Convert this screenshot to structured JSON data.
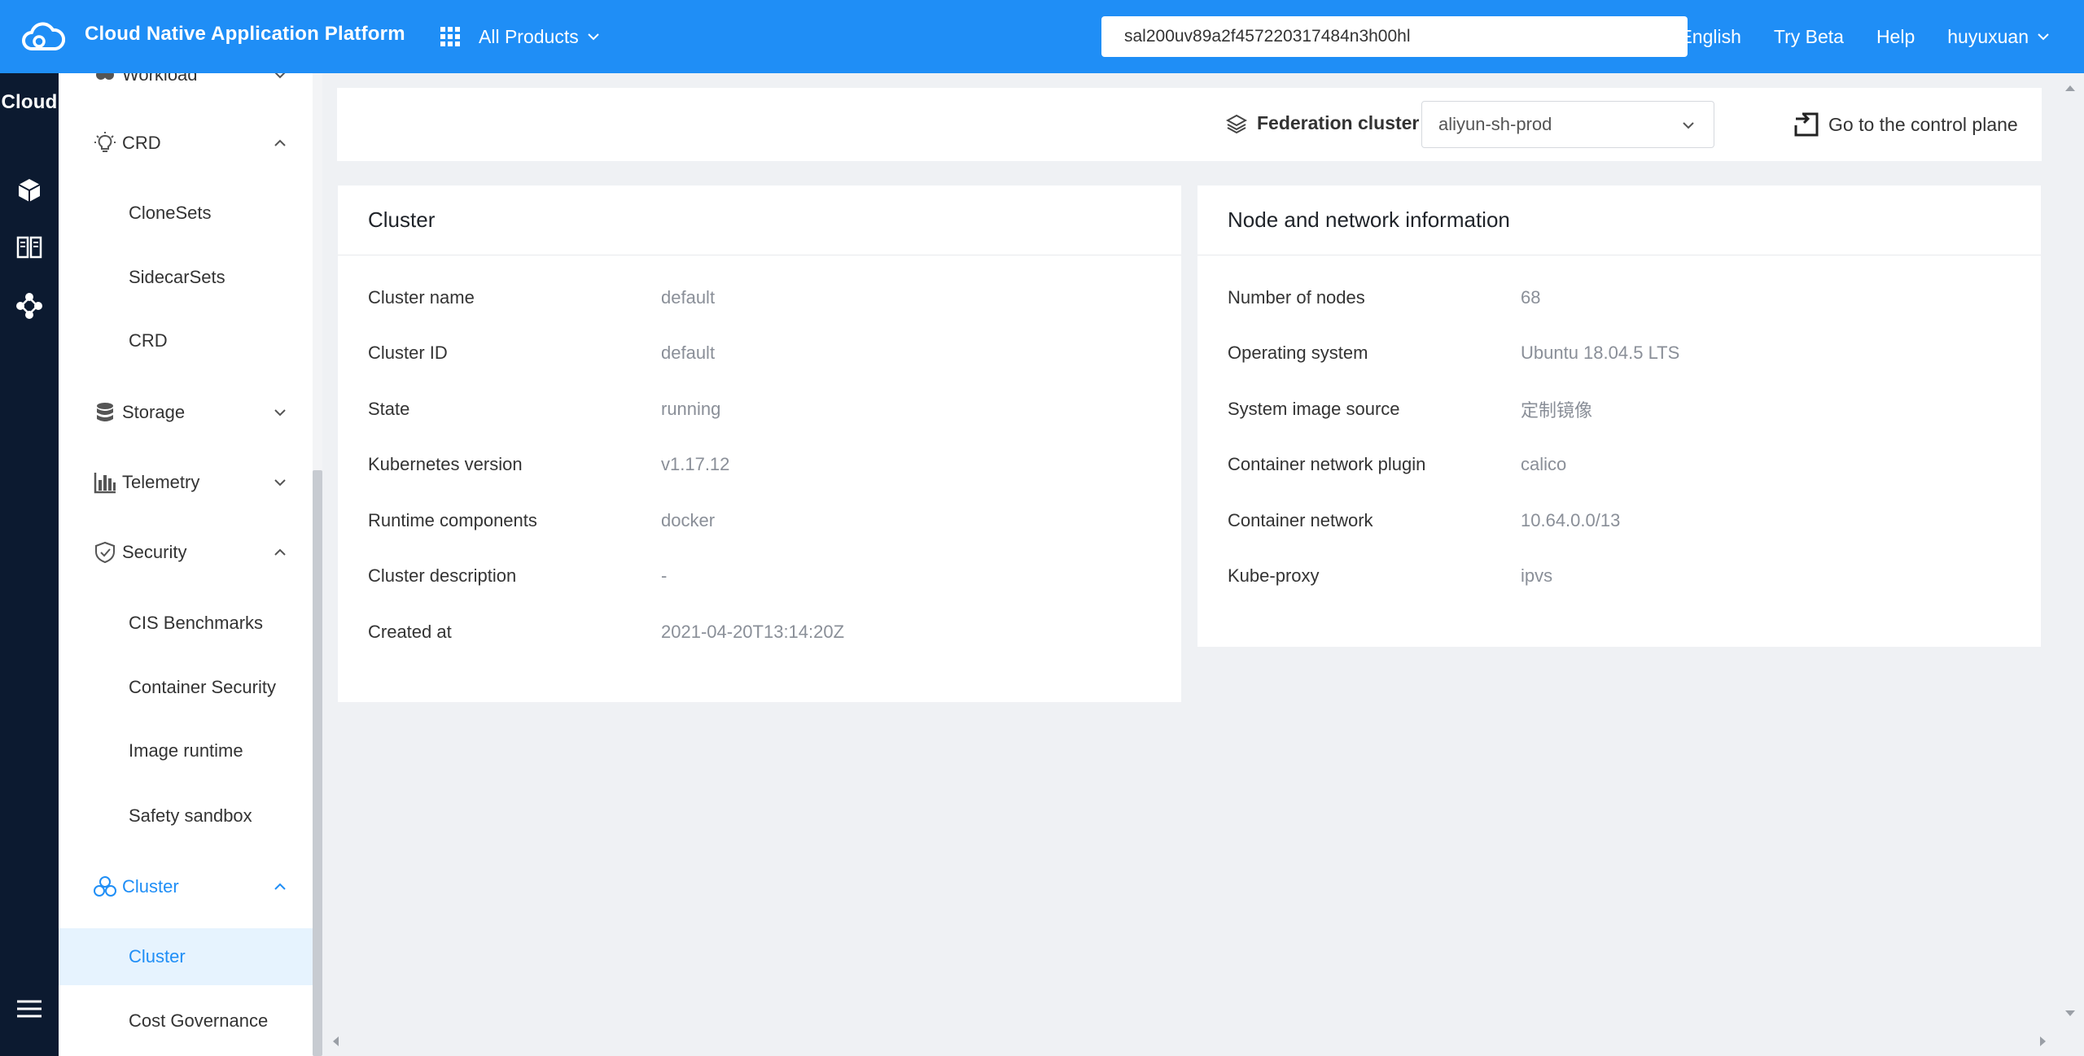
{
  "header": {
    "app_title": "Cloud Native Application Platform",
    "products_label": "All Products",
    "search_value": "sal200uv89a2f457220317484n3h00hl",
    "links": [
      "English",
      "Try Beta",
      "Help"
    ],
    "user": "huyuxuan"
  },
  "rail": {
    "title": "Cloud",
    "icons": [
      "cube-icon",
      "book-icon",
      "network-icon"
    ],
    "menu_icon": "hamburger-icon"
  },
  "sidebar": {
    "workload": "Workload",
    "crd": {
      "label": "CRD",
      "items": [
        "CloneSets",
        "SidecarSets",
        "CRD"
      ]
    },
    "storage": "Storage",
    "telemetry": "Telemetry",
    "security": {
      "label": "Security",
      "items": [
        "CIS Benchmarks",
        "Container Security",
        "Image runtime",
        "Safety sandbox"
      ]
    },
    "cluster": {
      "label": "Cluster",
      "items": [
        "Cluster",
        "Cost Governance"
      ]
    }
  },
  "federation": {
    "label": "Federation cluster",
    "selected": "aliyun-sh-prod",
    "control_plane": "Go to the control plane"
  },
  "cluster_card": {
    "title": "Cluster",
    "rows": [
      {
        "key": "Cluster name",
        "value": "default"
      },
      {
        "key": "Cluster ID",
        "value": "default"
      },
      {
        "key": "State",
        "value": "running"
      },
      {
        "key": "Kubernetes version",
        "value": "v1.17.12"
      },
      {
        "key": "Runtime components",
        "value": "docker"
      },
      {
        "key": "Cluster description",
        "value": "-"
      },
      {
        "key": "Created at",
        "value": "2021-04-20T13:14:20Z"
      }
    ]
  },
  "node_card": {
    "title": "Node and network information",
    "rows": [
      {
        "key": "Number of nodes",
        "value": "68"
      },
      {
        "key": "Operating system",
        "value": "Ubuntu 18.04.5 LTS"
      },
      {
        "key": "System image source",
        "value": "定制镜像"
      },
      {
        "key": "Container network plugin",
        "value": "calico"
      },
      {
        "key": "Container network",
        "value": "10.64.0.0/13"
      },
      {
        "key": "Kube-proxy",
        "value": "ipvs"
      }
    ]
  },
  "colors": {
    "primary": "#1f8ef6",
    "rail": "#0c1a30",
    "background": "#eff1f4",
    "selected_bg": "#e6f3fe"
  }
}
